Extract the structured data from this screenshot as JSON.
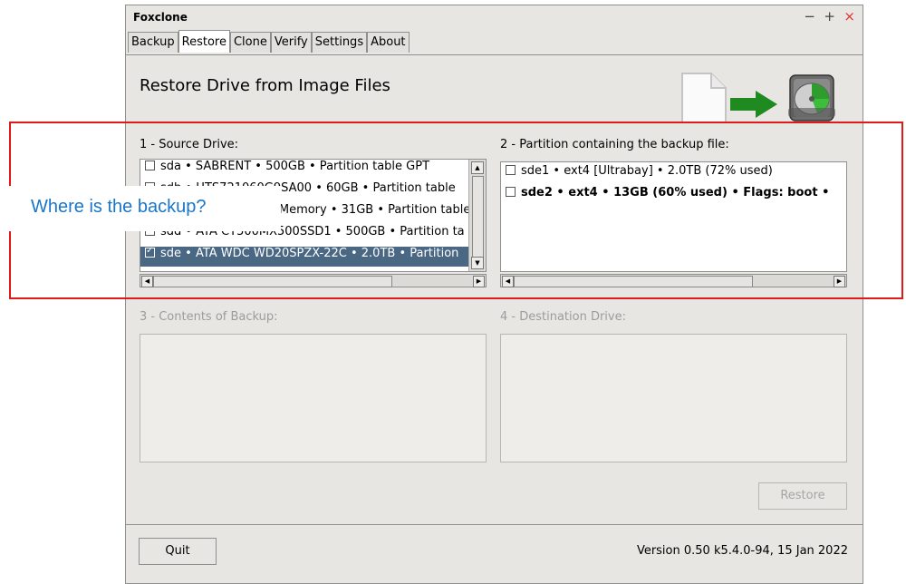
{
  "window": {
    "title": "Foxclone",
    "controls": {
      "minimize": "−",
      "maximize": "+",
      "close": "×"
    }
  },
  "tabs": [
    {
      "label": "Backup",
      "active": false
    },
    {
      "label": "Restore",
      "active": true
    },
    {
      "label": "Clone",
      "active": false
    },
    {
      "label": "Verify",
      "active": false
    },
    {
      "label": "Settings",
      "active": false
    },
    {
      "label": "About",
      "active": false
    }
  ],
  "header": {
    "title": "Restore Drive from Image Files"
  },
  "source": {
    "label": "1 - Source Drive:",
    "items": [
      {
        "text": "sda • SABRENT   • 500GB • Partition table GPT",
        "checked": false,
        "selected": false
      },
      {
        "text": "sdb • HTS721060G9SA00 • 60GB • Partition table",
        "checked": false,
        "selected": false
      },
      {
        "text": "sdc • Generic Flash Memory • 31GB • Partition table",
        "checked": false,
        "selected": false
      },
      {
        "text": "sdd • ATA CT500MX500SSD1 • 500GB • Partition ta",
        "checked": false,
        "selected": false
      },
      {
        "text": "sde • ATA WDC WD20SPZX-22C • 2.0TB • Partition",
        "checked": true,
        "selected": true
      }
    ]
  },
  "partition": {
    "label": "2 - Partition containing the backup file:",
    "items": [
      {
        "text": "sde1 • ext4 [Ultrabay] • 2.0TB (72% used)",
        "bold": false
      },
      {
        "text": "sde2 • ext4 • 13GB (60% used) • Flags: boot •",
        "bold": true
      }
    ]
  },
  "contents": {
    "label": "3 - Contents of Backup:"
  },
  "destination": {
    "label": "4 - Destination Drive:"
  },
  "buttons": {
    "restore": "Restore",
    "quit": "Quit"
  },
  "footer": {
    "version": "Version 0.50 k5.4.0-94, 15 Jan 2022"
  },
  "annotation": {
    "callout": "Where is the backup?",
    "color": "#e01a1a",
    "text_color": "#1976c8"
  }
}
